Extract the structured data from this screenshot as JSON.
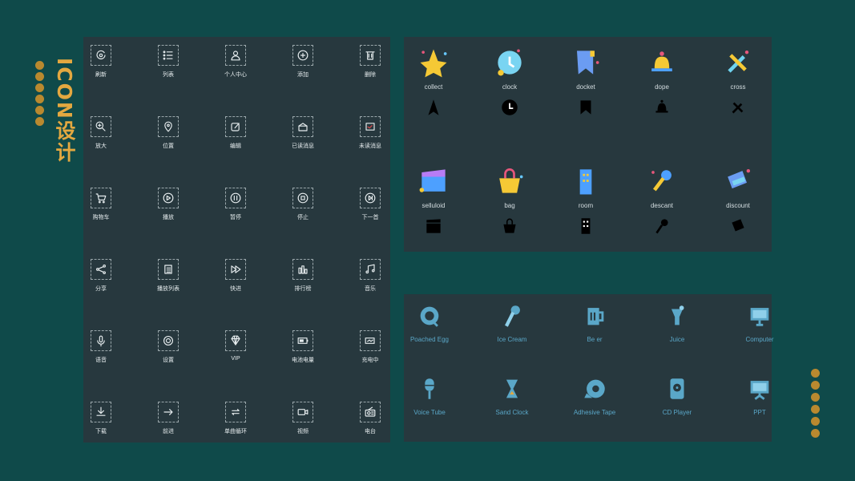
{
  "title": "ICON设计",
  "line_icons": [
    {
      "icon": "refresh",
      "label": "刷新"
    },
    {
      "icon": "list",
      "label": "列表"
    },
    {
      "icon": "user",
      "label": "个人中心"
    },
    {
      "icon": "add",
      "label": "添加"
    },
    {
      "icon": "delete",
      "label": "删除"
    },
    {
      "icon": "zoom-in",
      "label": "放大"
    },
    {
      "icon": "location",
      "label": "位置"
    },
    {
      "icon": "edit",
      "label": "编辑"
    },
    {
      "icon": "read-message",
      "label": "已读消息"
    },
    {
      "icon": "unread-message",
      "label": "未读消息"
    },
    {
      "icon": "cart",
      "label": "购物车"
    },
    {
      "icon": "play",
      "label": "播放"
    },
    {
      "icon": "pause",
      "label": "暂停"
    },
    {
      "icon": "stop",
      "label": "停止"
    },
    {
      "icon": "next",
      "label": "下一首"
    },
    {
      "icon": "share",
      "label": "分享"
    },
    {
      "icon": "playlist",
      "label": "播放列表"
    },
    {
      "icon": "fast-forward",
      "label": "快进"
    },
    {
      "icon": "ranking",
      "label": "排行榜"
    },
    {
      "icon": "music",
      "label": "音乐"
    },
    {
      "icon": "voice",
      "label": "语音"
    },
    {
      "icon": "settings",
      "label": "设置"
    },
    {
      "icon": "diamond",
      "label": "VIP"
    },
    {
      "icon": "battery",
      "label": "电池电量"
    },
    {
      "icon": "charging",
      "label": "充电中"
    },
    {
      "icon": "download",
      "label": "下载"
    },
    {
      "icon": "forward",
      "label": "前进"
    },
    {
      "icon": "loop",
      "label": "单曲循环"
    },
    {
      "icon": "video",
      "label": "视频"
    },
    {
      "icon": "radio",
      "label": "电台"
    }
  ],
  "color_icons": [
    {
      "icon": "star",
      "label": "collect"
    },
    {
      "icon": "clock",
      "label": "clock"
    },
    {
      "icon": "bookmark",
      "label": "docket"
    },
    {
      "icon": "bell",
      "label": "dope"
    },
    {
      "icon": "fork-spoon",
      "label": "cross"
    },
    {
      "icon": "clapperboard",
      "label": "selluloid"
    },
    {
      "icon": "bag",
      "label": "bag"
    },
    {
      "icon": "building",
      "label": "room"
    },
    {
      "icon": "microphone",
      "label": "descant"
    },
    {
      "icon": "ticket",
      "label": "discount"
    }
  ],
  "blue_icons": [
    {
      "icon": "egg",
      "label": "Poached Egg"
    },
    {
      "icon": "ice-cream",
      "label": "Ice Cream"
    },
    {
      "icon": "beer",
      "label": "Be er"
    },
    {
      "icon": "juice",
      "label": "Juice"
    },
    {
      "icon": "computer",
      "label": "Computer"
    },
    {
      "icon": "microphone",
      "label": "Voice Tube"
    },
    {
      "icon": "hourglass",
      "label": "Sand Clock"
    },
    {
      "icon": "tape",
      "label": "Adhesive Tape"
    },
    {
      "icon": "cd-player",
      "label": "CD Player"
    },
    {
      "icon": "presentation",
      "label": "PPT"
    }
  ],
  "colors": {
    "background": "#0f4a4a",
    "panel": "#27383e",
    "accent": "#e3a840",
    "blue": "#5aa7c8"
  }
}
